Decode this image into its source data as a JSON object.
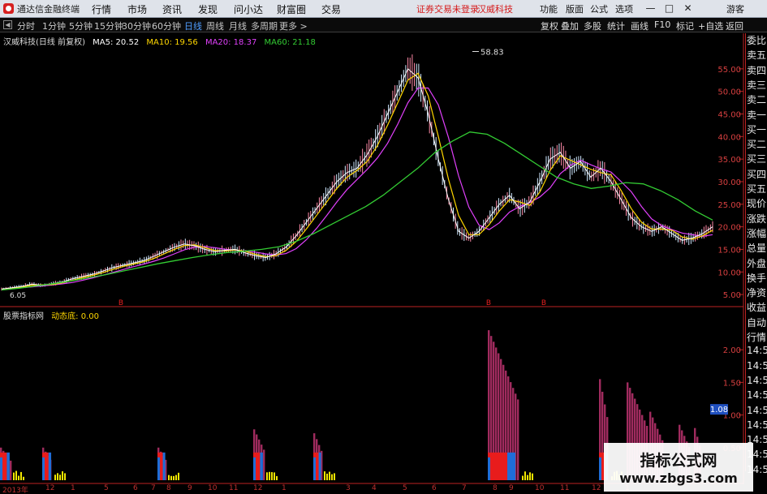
{
  "app": {
    "title": "通达信金融终端",
    "login_status": "证券交易未登录",
    "stock": "汉威科技"
  },
  "menu": [
    "行情",
    "市场",
    "资讯",
    "发现",
    "问小达",
    "财富圈",
    "交易"
  ],
  "top_right": [
    "功能",
    "版面",
    "公式",
    "选项"
  ],
  "window_buttons": [
    "—",
    "□",
    "✕"
  ],
  "periods": [
    "分时",
    "1分钟",
    "5分钟",
    "15分钟",
    "30分钟",
    "60分钟",
    "日线",
    "周线",
    "月线",
    "多周期",
    "更多 >"
  ],
  "active_period": "日线",
  "toolbar_right": [
    "复权",
    "叠加",
    "多股",
    "统计",
    "画线",
    "F10",
    "标记",
    "+自选",
    "返回"
  ],
  "main_legend": {
    "name": "汉威科技(日线 前复权)",
    "ma5": "MA5: 20.52",
    "ma10": "MA10: 19.56",
    "ma20": "MA20: 18.37",
    "ma60": "MA60: 21.18"
  },
  "sub_legend": {
    "name": "股票指标网",
    "value": "动态底: 0.00"
  },
  "side_panel": [
    "委比",
    "卖五",
    "卖四",
    "卖三",
    "卖二",
    "卖一",
    "买一",
    "买二",
    "买三",
    "买四",
    "买五",
    "现价",
    "涨跌",
    "涨幅",
    "总量",
    "外盘",
    "换手",
    "净资",
    "收益",
    "自动",
    "行情",
    "14:50",
    "14:50",
    "14:50",
    "14:50",
    "14:50",
    "14:50",
    "14:50",
    "14:50",
    "14:50"
  ],
  "colors": {
    "ma5": "#ffffff",
    "ma10": "#ffd700",
    "ma20": "#e040fb",
    "ma60": "#33cc33",
    "bar": "#a02b5e",
    "red_bar": "#e81c1c",
    "blue_bar": "#1f6ed8",
    "yellow": "#f2e600"
  },
  "chart_data": {
    "type": "line",
    "price_axis": {
      "ticks": [
        5,
        10,
        15,
        20,
        25,
        30,
        35,
        40,
        45,
        50,
        55
      ],
      "ylim": [
        2.5,
        60
      ]
    },
    "annotations": {
      "high": "58.83",
      "low": "6.05"
    },
    "close_path": [
      6.2,
      6.5,
      6.8,
      7.3,
      7.0,
      7.4,
      7.8,
      8.5,
      9.0,
      9.5,
      10.2,
      11.0,
      11.5,
      12.0,
      12.5,
      13.5,
      14.5,
      15.5,
      16.2,
      15.8,
      15.0,
      14.5,
      14.8,
      15.0,
      14.2,
      13.6,
      13.2,
      14.0,
      15.5,
      18.0,
      21.0,
      24.0,
      27.0,
      30.0,
      32.0,
      33.0,
      36.0,
      40.0,
      45.0,
      50.0,
      55.0,
      53.0,
      45.0,
      35.0,
      26.0,
      19.0,
      17.5,
      19.0,
      22.0,
      25.0,
      27.0,
      24.0,
      25.5,
      30.0,
      35.0,
      36.5,
      33.0,
      34.5,
      31.0,
      33.0,
      30.0,
      26.0,
      22.0,
      20.0,
      19.0,
      20.0,
      18.5,
      17.0,
      17.5,
      18.5,
      20.0
    ],
    "ma60_path": [
      6.0,
      6.4,
      6.9,
      7.4,
      8.0,
      8.7,
      9.4,
      10.2,
      11.0,
      11.8,
      12.5,
      13.2,
      13.8,
      14.3,
      14.6,
      15.0,
      15.6,
      16.8,
      18.5,
      20.5,
      22.5,
      24.5,
      27.0,
      30.0,
      33.0,
      36.5,
      39.0,
      41.0,
      40.5,
      38.5,
      36.0,
      33.5,
      31.0,
      29.5,
      28.5,
      29.0,
      29.8,
      29.5,
      28.0,
      26.0,
      23.5,
      21.5
    ],
    "x_axis": {
      "labels": [
        "2013年",
        "12",
        "1",
        "5",
        "6",
        "7",
        "8",
        "9",
        "10",
        "11",
        "12",
        "1",
        "3",
        "4",
        "5",
        "6",
        "7",
        "8",
        "9",
        "10",
        "11",
        "12",
        "1"
      ]
    },
    "sub_axis": {
      "ticks": [
        0.5,
        1.0,
        1.5,
        2.0
      ],
      "highlight": "1.08"
    },
    "sub_bars": [
      {
        "x": 0,
        "w": 14,
        "h": 0.5,
        "red": 0.25,
        "blue": 0.25
      },
      {
        "x": 52,
        "w": 13,
        "h": 0.5,
        "red": 0.25,
        "blue": 0.25
      },
      {
        "x": 194,
        "w": 11,
        "h": 0.5,
        "red": 0.25,
        "blue": 0.25
      },
      {
        "x": 312,
        "w": 14,
        "h": 0.78,
        "red": 0.25,
        "blue": 0.25
      },
      {
        "x": 386,
        "w": 11,
        "h": 0.72,
        "red": 0.25,
        "blue": 0.25
      },
      {
        "x": 601,
        "w": 40,
        "h": 2.3,
        "red": 0.25,
        "blue": 0.25
      },
      {
        "x": 738,
        "w": 13,
        "h": 1.55,
        "red": 0.25,
        "blue": 0.25
      },
      {
        "x": 772,
        "w": 28,
        "h": 1.5,
        "red": 0,
        "blue": 0
      },
      {
        "x": 800,
        "w": 18,
        "h": 1.05,
        "red": 0,
        "blue": 0
      },
      {
        "x": 836,
        "w": 14,
        "h": 0.85,
        "red": 0,
        "blue": 0
      },
      {
        "x": 855,
        "w": 8,
        "h": 0.8,
        "red": 0,
        "blue": 0
      }
    ]
  },
  "watermark": {
    "title": "指标公式网",
    "url": "www.zbgs3.com"
  }
}
